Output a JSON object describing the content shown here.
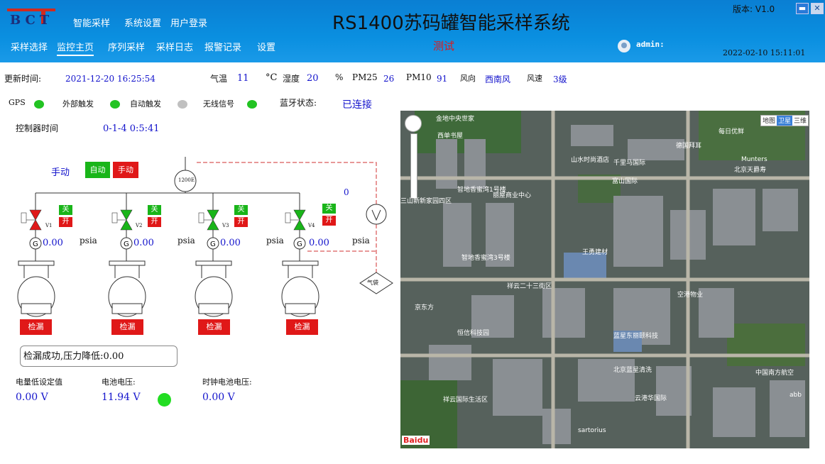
{
  "header": {
    "logo_text": "BCT",
    "menu": [
      "智能采样",
      "系统设置",
      "用户登录"
    ],
    "title": "RS1400苏码罐智能采样系统",
    "version": "版本: V1.0",
    "nav": [
      "采样选择",
      "监控主页",
      "序列采样",
      "采样日志",
      "报警记录",
      "设置"
    ],
    "active_nav": "监控主页",
    "test_label": "测试",
    "user": "admin:",
    "clock": "2022-02-10 15:11:01"
  },
  "status": {
    "update_label": "更新时间:",
    "update_time": "2021-12-20 16:25:54",
    "temp_label": "气温",
    "temp_value": "11",
    "temp_unit": "°C",
    "humidity_label": "湿度",
    "humidity_value": "20",
    "humidity_unit": "%",
    "pm25_label": "PM25",
    "pm25_value": "26",
    "pm10_label": "PM10",
    "pm10_value": "91",
    "wind_dir_label": "风向",
    "wind_dir_value": "西南风",
    "wind_speed_label": "风速",
    "wind_speed_value": "3级"
  },
  "signals": {
    "gps_label": "GPS",
    "ext_trigger_label": "外部触发",
    "auto_trigger_label": "自动触发",
    "wireless_label": "无线信号",
    "bt_label": "蓝牙状态:",
    "bt_value": "已连接",
    "colors": {
      "on": "#22c322",
      "off": "#c0c0c0"
    }
  },
  "controller": {
    "label": "控制器时间",
    "value": "0-1-4 0:5:41"
  },
  "control": {
    "mode_label": "手动",
    "auto_btn": "自动",
    "manual_btn": "手动",
    "flow_box": "1200E",
    "flow_value": "0",
    "bag_label": "气袋",
    "open_label": "开",
    "close_label": "关",
    "psia": "psia",
    "leak_btn": "检漏"
  },
  "canisters": [
    {
      "valve": "V1",
      "pressure": "0.00",
      "valve_state": "closed"
    },
    {
      "valve": "V2",
      "pressure": "0.00",
      "valve_state": "open"
    },
    {
      "valve": "V3",
      "pressure": "0.00",
      "valve_state": "open"
    },
    {
      "valve": "V4",
      "pressure": "0.00",
      "valve_state": "open"
    }
  ],
  "message": "检漏成功,压力降低:0.00",
  "power": {
    "low_label": "电量低设定值",
    "low_value": "0.00 V",
    "battery_label": "电池电压:",
    "battery_value": "11.94 V",
    "clock_label": "时钟电池电压:",
    "clock_value": "0.00 V"
  },
  "map": {
    "type_buttons": [
      "地图",
      "卫星",
      "三维"
    ],
    "labels": [
      "金地中央世家",
      "西单书屋",
      "山水时尚酒店",
      "千里马国际",
      "德国拜耳",
      "每日优鲜",
      "智地香蜜湾1号楼",
      "丽屋商业中心",
      "富山国际",
      "北京天爵寿",
      "王勇建材",
      "智地香蜜湾3号楼",
      "三山新新家园四区",
      "祥云二十三街区",
      "京东方",
      "恒信科技园",
      "蓝星东丽颐科技",
      "空港物业",
      "北京蓝星清洗",
      "云港华国际",
      "sartorius",
      "中国南方航空",
      "祥云国际生活区",
      "Munters",
      "abb"
    ],
    "brand": "Baidu"
  }
}
